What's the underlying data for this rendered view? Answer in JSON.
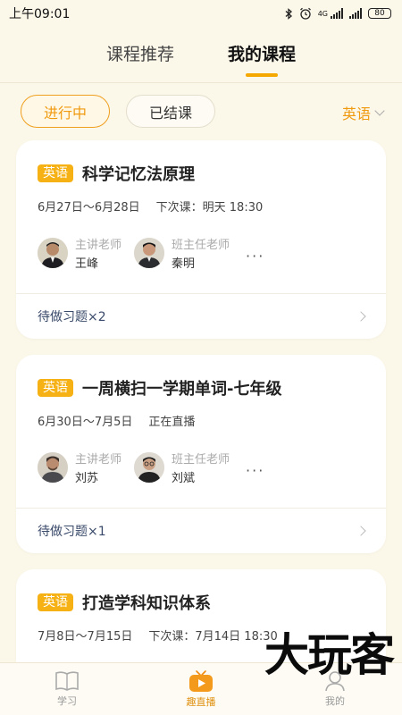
{
  "status_bar": {
    "time": "上午09:01",
    "network": "4G",
    "battery": "80"
  },
  "top_tabs": [
    {
      "label": "课程推荐",
      "active": false
    },
    {
      "label": "我的课程",
      "active": true
    }
  ],
  "filters": {
    "active_label": "进行中",
    "inactive_label": "已结课",
    "subject": "英语"
  },
  "courses": [
    {
      "tag": "英语",
      "title": "科学记忆法原理",
      "dates": "6月27日～6月28日",
      "next": "下次课：明天 18:30",
      "teachers": [
        {
          "role": "主讲老师",
          "name": "王峰"
        },
        {
          "role": "班主任老师",
          "name": "秦明"
        }
      ],
      "more": "···",
      "todo": "待做习题×2"
    },
    {
      "tag": "英语",
      "title": "一周横扫一学期单词-七年级",
      "dates": "6月30日～7月5日",
      "next": "正在直播",
      "teachers": [
        {
          "role": "主讲老师",
          "name": "刘苏"
        },
        {
          "role": "班主任老师",
          "name": "刘斌"
        }
      ],
      "more": "···",
      "todo": "待做习题×1"
    },
    {
      "tag": "英语",
      "title": "打造学科知识体系",
      "dates": "7月8日～7月15日",
      "next": "下次课：7月14日 18:30"
    }
  ],
  "bottom_nav": [
    {
      "label": "学习",
      "icon": "book-icon",
      "active": false
    },
    {
      "label": "趣直播",
      "icon": "tv-play-icon",
      "active": true
    },
    {
      "label": "我的",
      "icon": "person-icon",
      "active": false
    }
  ],
  "watermark": "大玩客",
  "colors": {
    "accent": "#f5a800",
    "background": "#fbf7e9",
    "tag": "#f6b114"
  }
}
